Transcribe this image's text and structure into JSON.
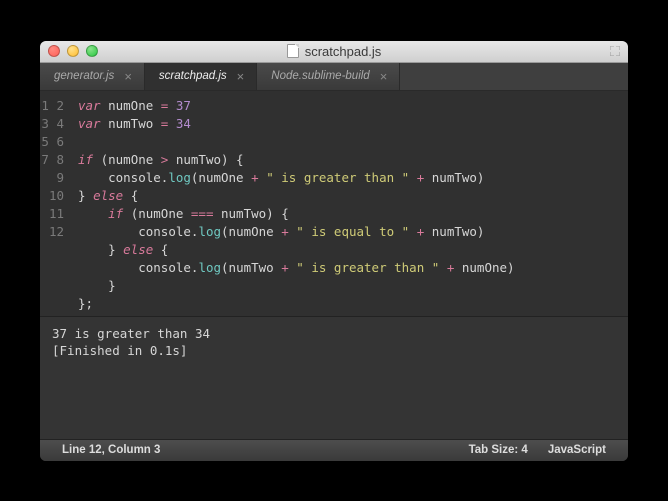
{
  "window": {
    "title": "scratchpad.js"
  },
  "tabs": [
    {
      "label": "generator.js",
      "active": false
    },
    {
      "label": "scratchpad.js",
      "active": true
    },
    {
      "label": "Node.sublime-build",
      "active": false
    }
  ],
  "code": {
    "line_count": 12,
    "tokens": [
      [
        [
          "kw",
          "var"
        ],
        [
          "ident",
          " numOne "
        ],
        [
          "op",
          "="
        ],
        [
          "ident",
          " "
        ],
        [
          "num",
          "37"
        ]
      ],
      [
        [
          "kw",
          "var"
        ],
        [
          "ident",
          " numTwo "
        ],
        [
          "op",
          "="
        ],
        [
          "ident",
          " "
        ],
        [
          "num",
          "34"
        ]
      ],
      [],
      [
        [
          "kw",
          "if"
        ],
        [
          "punc",
          " (numOne "
        ],
        [
          "op",
          ">"
        ],
        [
          "punc",
          " numTwo) {"
        ]
      ],
      [
        [
          "punc",
          "    "
        ],
        [
          "obj",
          "console"
        ],
        [
          "punc",
          "."
        ],
        [
          "fn",
          "log"
        ],
        [
          "punc",
          "(numOne "
        ],
        [
          "op",
          "+"
        ],
        [
          "punc",
          " "
        ],
        [
          "str",
          "\" is greater than \""
        ],
        [
          "punc",
          " "
        ],
        [
          "op",
          "+"
        ],
        [
          "punc",
          " numTwo)"
        ]
      ],
      [
        [
          "punc",
          "} "
        ],
        [
          "kw",
          "else"
        ],
        [
          "punc",
          " {"
        ]
      ],
      [
        [
          "punc",
          "    "
        ],
        [
          "kw",
          "if"
        ],
        [
          "punc",
          " (numOne "
        ],
        [
          "op",
          "==="
        ],
        [
          "punc",
          " numTwo) {"
        ]
      ],
      [
        [
          "punc",
          "        "
        ],
        [
          "obj",
          "console"
        ],
        [
          "punc",
          "."
        ],
        [
          "fn",
          "log"
        ],
        [
          "punc",
          "(numOne "
        ],
        [
          "op",
          "+"
        ],
        [
          "punc",
          " "
        ],
        [
          "str",
          "\" is equal to \""
        ],
        [
          "punc",
          " "
        ],
        [
          "op",
          "+"
        ],
        [
          "punc",
          " numTwo)"
        ]
      ],
      [
        [
          "punc",
          "    } "
        ],
        [
          "kw",
          "else"
        ],
        [
          "punc",
          " {"
        ]
      ],
      [
        [
          "punc",
          "        "
        ],
        [
          "obj",
          "console"
        ],
        [
          "punc",
          "."
        ],
        [
          "fn",
          "log"
        ],
        [
          "punc",
          "(numTwo "
        ],
        [
          "op",
          "+"
        ],
        [
          "punc",
          " "
        ],
        [
          "str",
          "\" is greater than \""
        ],
        [
          "punc",
          " "
        ],
        [
          "op",
          "+"
        ],
        [
          "punc",
          " numOne)"
        ]
      ],
      [
        [
          "punc",
          "    }"
        ]
      ],
      [
        [
          "punc",
          "};"
        ]
      ]
    ]
  },
  "output": {
    "lines": [
      "37 is greater than 34",
      "[Finished in 0.1s]"
    ]
  },
  "status": {
    "position": "Line 12, Column 3",
    "tab_size": "Tab Size: 4",
    "syntax": "JavaScript"
  }
}
